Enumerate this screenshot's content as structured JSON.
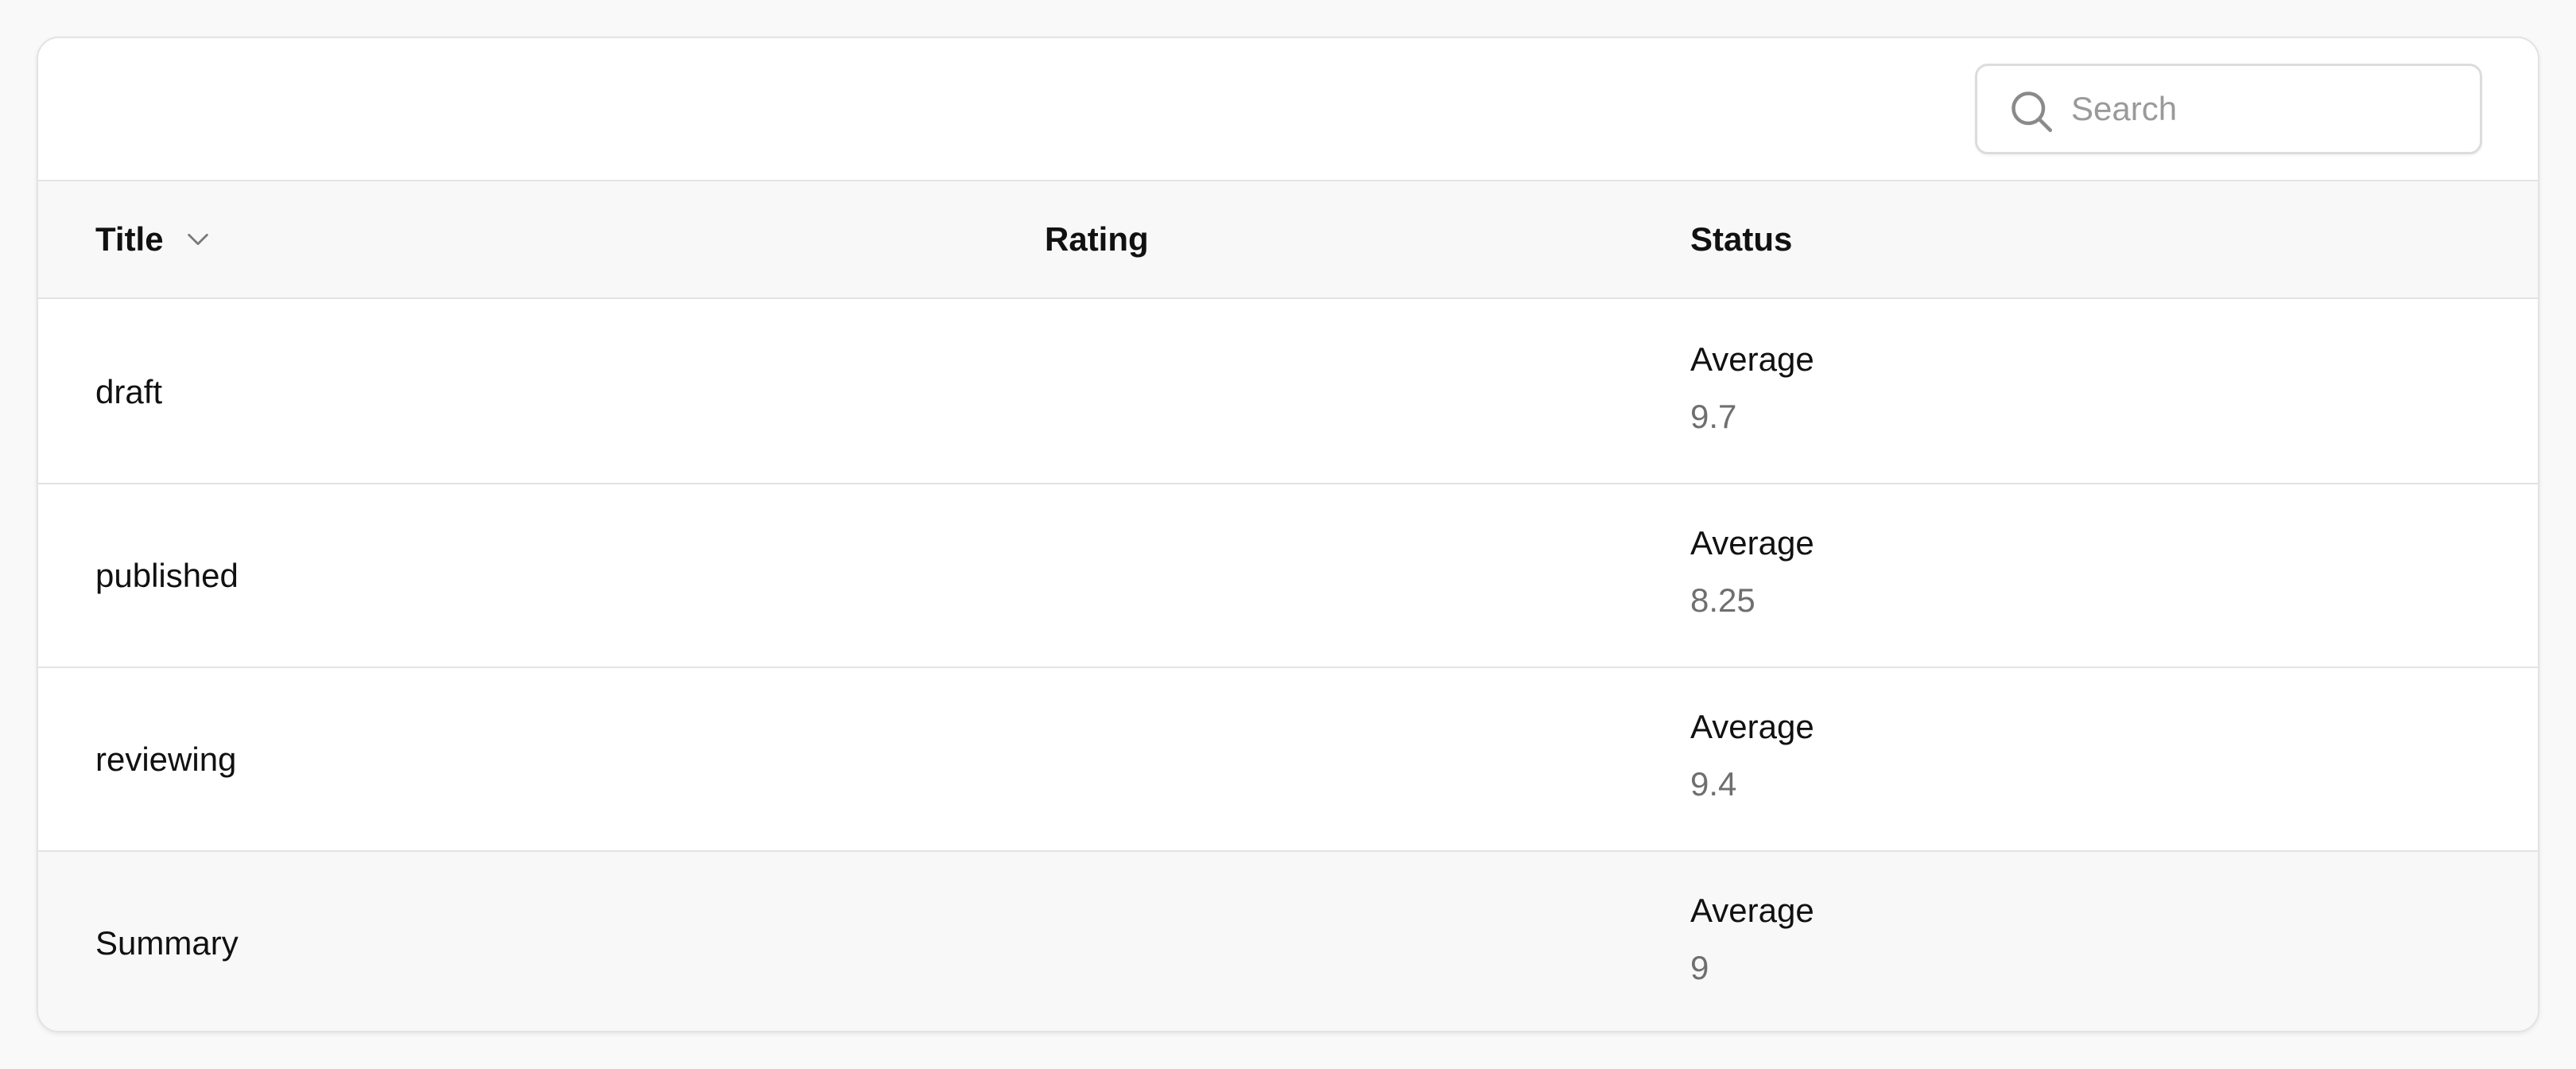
{
  "search": {
    "placeholder": "Search",
    "value": "",
    "icon": "search-icon"
  },
  "table": {
    "columns": {
      "title": "Title",
      "rating": "Rating",
      "status": "Status",
      "sort_icon": "chevron-down-icon"
    },
    "rows": [
      {
        "title": "draft",
        "rating": "",
        "status_label": "Average",
        "status_value": "9.7"
      },
      {
        "title": "published",
        "rating": "",
        "status_label": "Average",
        "status_value": "8.25"
      },
      {
        "title": "reviewing",
        "rating": "",
        "status_label": "Average",
        "status_value": "9.4"
      }
    ],
    "summary": {
      "title": "Summary",
      "status_label": "Average",
      "status_value": "9"
    }
  },
  "colors": {
    "page_background": "#f9f9f9",
    "card_background": "#ffffff",
    "header_background": "#f8f8f8",
    "border": "#e3e3e3",
    "text_primary": "#111111",
    "text_muted": "#6f6f6f",
    "placeholder": "#9a9a9a"
  }
}
